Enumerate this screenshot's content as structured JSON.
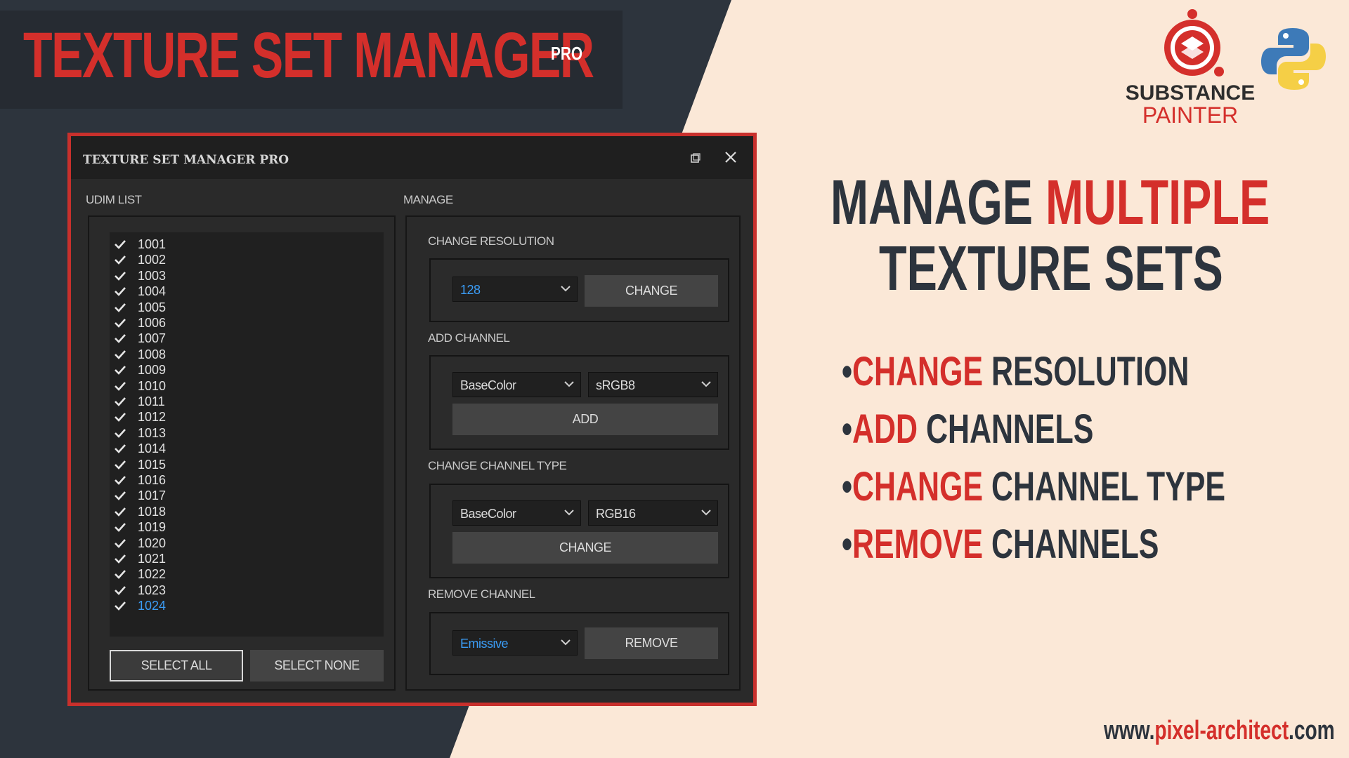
{
  "banner": {
    "title": "TEXTURE SET MANAGER",
    "superscript": "PRO"
  },
  "logos": {
    "substance": {
      "line1": "SUBSTANCE",
      "line2": "PAINTER",
      "icon": "substance-painter-icon"
    },
    "python": {
      "icon": "python-icon"
    }
  },
  "window": {
    "title": "TEXTURE SET MANAGER PRO",
    "udim_list_label": "UDIM LIST",
    "manage_label": "MANAGE",
    "udims": [
      "1001",
      "1002",
      "1003",
      "1004",
      "1005",
      "1006",
      "1007",
      "1008",
      "1009",
      "1010",
      "1011",
      "1012",
      "1013",
      "1014",
      "1015",
      "1016",
      "1017",
      "1018",
      "1019",
      "1020",
      "1021",
      "1022",
      "1023",
      "1024"
    ],
    "selected_udim": "1024",
    "select_all": "SELECT ALL",
    "select_none": "SELECT NONE",
    "change_resolution": {
      "label": "CHANGE RESOLUTION",
      "value": "128",
      "button": "CHANGE"
    },
    "add_channel": {
      "label": "ADD CHANNEL",
      "channel": "BaseColor",
      "format": "sRGB8",
      "button": "ADD"
    },
    "change_channel_type": {
      "label": "CHANGE CHANNEL TYPE",
      "channel": "BaseColor",
      "format": "RGB16",
      "button": "CHANGE"
    },
    "remove_channel": {
      "label": "REMOVE CHANNEL",
      "channel": "Emissive",
      "button": "REMOVE"
    }
  },
  "headline": {
    "line1_a": "MANAGE ",
    "line1_b": "MULTIPLE",
    "line2": "TEXTURE SETS"
  },
  "features": [
    {
      "bullet": "•",
      "accent": "CHANGE",
      "rest": " RESOLUTION"
    },
    {
      "bullet": "•",
      "accent": "ADD",
      "rest": " CHANNELS"
    },
    {
      "bullet": "•",
      "accent": "CHANGE",
      "rest": " CHANNEL TYPE"
    },
    {
      "bullet": "•",
      "accent": "REMOVE",
      "rest": " CHANNELS"
    }
  ],
  "url": {
    "prefix": "www.",
    "accent": "pixel-architect",
    "suffix": ".com"
  },
  "colors": {
    "accent": "#d42f2b",
    "dark": "#2d343d",
    "cream": "#fbe8d7",
    "selection_blue": "#3b9cf5"
  }
}
